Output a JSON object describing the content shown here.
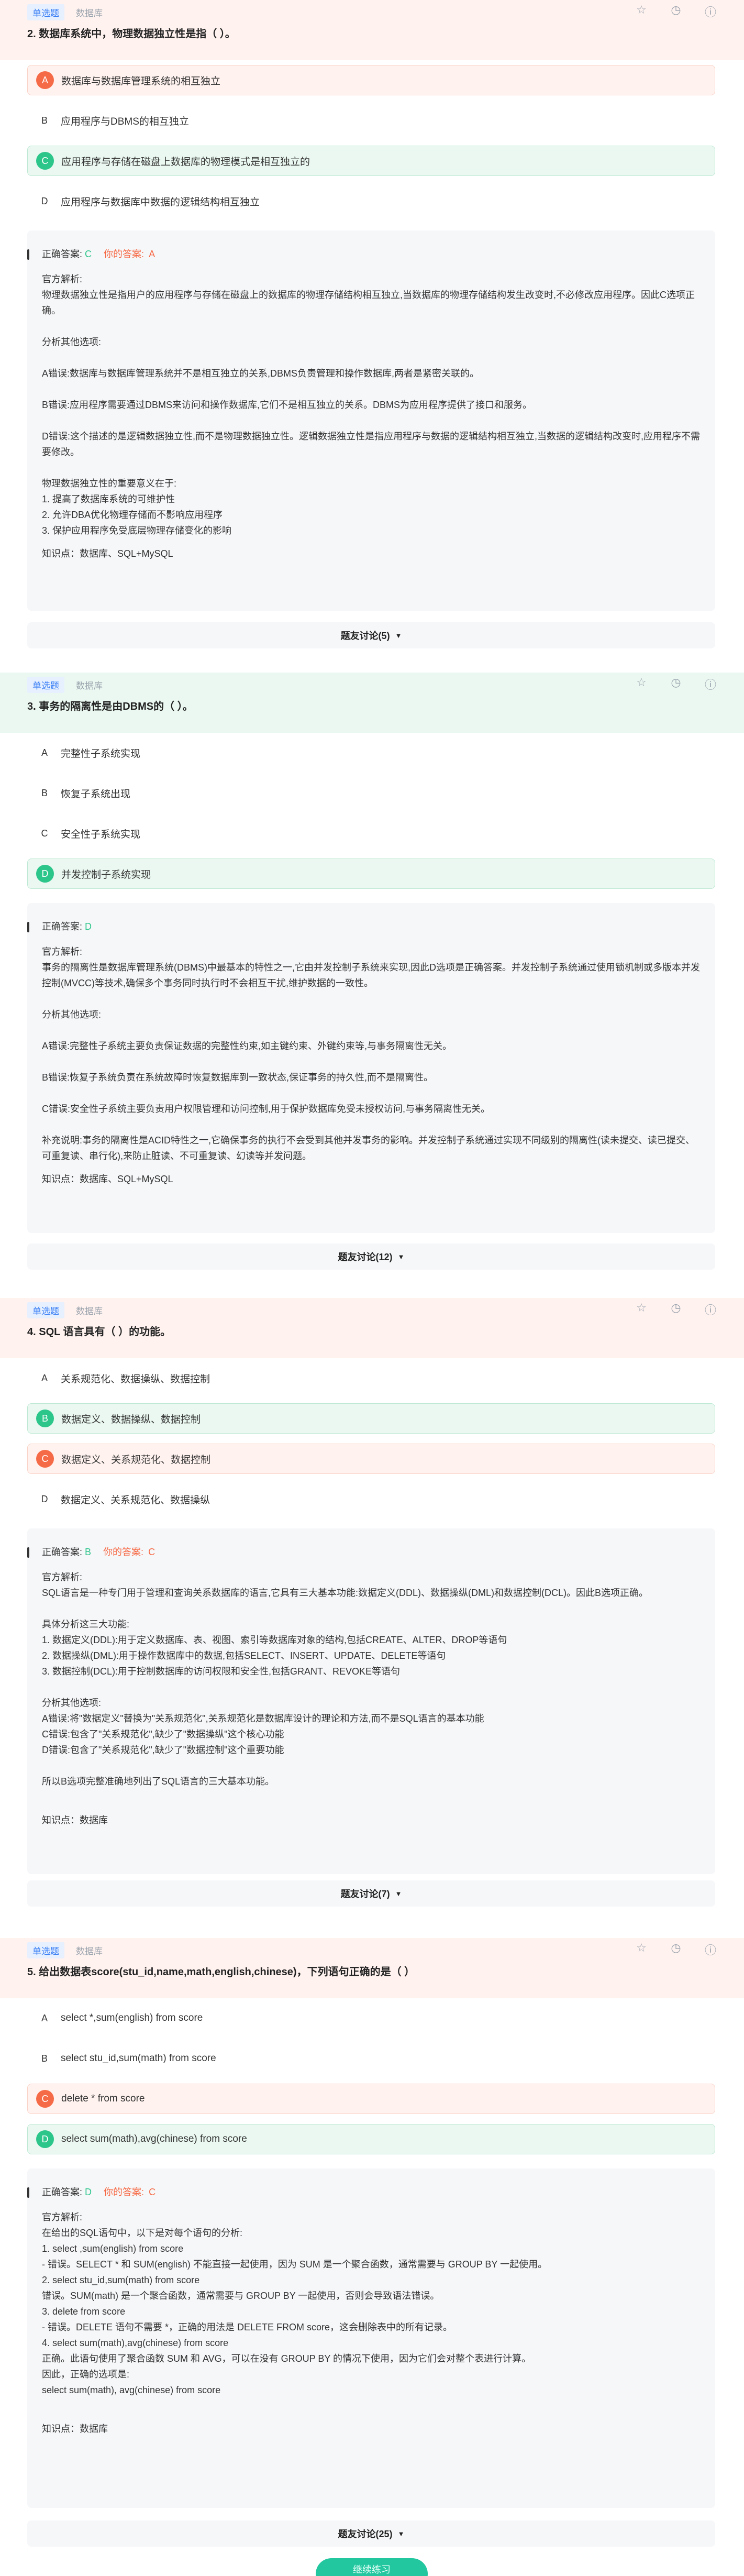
{
  "common": {
    "tag_type": "单选题",
    "tag_subject": "数据库",
    "correct_answer_label": "正确答案:",
    "my_answer_label": "你的答案:",
    "analysis_label": "官方解析:",
    "icons": [
      "star-icon",
      "clock-icon",
      "info-icon"
    ],
    "colors": {
      "correct": "#2cc58a",
      "wrong": "#f66b47",
      "accent": "#3b7ff5"
    }
  },
  "questions": [
    {
      "title": "2. 数据库系统中，物理数据独立性是指（ ）。",
      "options": [
        {
          "letter": "A",
          "text": "数据库与数据库管理系统的相互独立",
          "state": "wrong"
        },
        {
          "letter": "B",
          "text": "应用程序与DBMS的相互独立",
          "state": "none"
        },
        {
          "letter": "C",
          "text": "应用程序与存储在磁盘上数据库的物理模式是相互独立的",
          "state": "correct"
        },
        {
          "letter": "D",
          "text": "应用程序与数据库中数据的逻辑结构相互独立",
          "state": "none"
        }
      ],
      "correct": "C",
      "mine": "A",
      "explanation": [
        "物理数据独立性是指用户的应用程序与存储在磁盘上的数据库的物理存储结构相互独立,当数据库的物理存储结构发生改变时,不必修改应用程序。因此C选项正确。",
        "",
        "分析其他选项:",
        "",
        "A错误:数据库与数据库管理系统并不是相互独立的关系,DBMS负责管理和操作数据库,两者是紧密关联的。",
        "",
        "B错误:应用程序需要通过DBMS来访问和操作数据库,它们不是相互独立的关系。DBMS为应用程序提供了接口和服务。",
        "",
        "D错误:这个描述的是逻辑数据独立性,而不是物理数据独立性。逻辑数据独立性是指应用程序与数据的逻辑结构相互独立,当数据的逻辑结构改变时,应用程序不需要修改。",
        "",
        "物理数据独立性的重要意义在于:",
        "1. 提高了数据库系统的可维护性",
        "2. 允许DBA优化物理存储而不影响应用程序",
        "3. 保护应用程序免受底层物理存储变化的影响"
      ],
      "knowledge": "知识点：数据库、SQL+MySQL",
      "discussion": "题友讨论(5)"
    },
    {
      "title": "3. 事务的隔离性是由DBMS的（ ）。",
      "options": [
        {
          "letter": "A",
          "text": "完整性子系统实现",
          "state": "none"
        },
        {
          "letter": "B",
          "text": "恢复子系统出现",
          "state": "none"
        },
        {
          "letter": "C",
          "text": "安全性子系统实现",
          "state": "none"
        },
        {
          "letter": "D",
          "text": "并发控制子系统实现",
          "state": "correct"
        }
      ],
      "correct": "D",
      "mine": "",
      "explanation": [
        "事务的隔离性是数据库管理系统(DBMS)中最基本的特性之一,它由并发控制子系统来实现,因此D选项是正确答案。并发控制子系统通过使用锁机制或多版本并发控制(MVCC)等技术,确保多个事务同时执行时不会相互干扰,维护数据的一致性。",
        "",
        "分析其他选项:",
        "",
        "A错误:完整性子系统主要负责保证数据的完整性约束,如主键约束、外键约束等,与事务隔离性无关。",
        "",
        "B错误:恢复子系统负责在系统故障时恢复数据库到一致状态,保证事务的持久性,而不是隔离性。",
        "",
        "C错误:安全性子系统主要负责用户权限管理和访问控制,用于保护数据库免受未授权访问,与事务隔离性无关。",
        "",
        "补充说明:事务的隔离性是ACID特性之一,它确保事务的执行不会受到其他并发事务的影响。并发控制子系统通过实现不同级别的隔离性(读未提交、读已提交、可重复读、串行化),来防止脏读、不可重复读、幻读等并发问题。"
      ],
      "knowledge": "知识点：数据库、SQL+MySQL",
      "discussion": "题友讨论(12)"
    },
    {
      "title": "4. SQL 语言具有（ ）的功能。",
      "options": [
        {
          "letter": "A",
          "text": "关系规范化、数据操纵、数据控制",
          "state": "none"
        },
        {
          "letter": "B",
          "text": "数据定义、数据操纵、数据控制",
          "state": "correct"
        },
        {
          "letter": "C",
          "text": "数据定义、关系规范化、数据控制",
          "state": "wrong"
        },
        {
          "letter": "D",
          "text": "数据定义、关系规范化、数据操纵",
          "state": "none"
        }
      ],
      "correct": "B",
      "mine": "C",
      "explanation": [
        "SQL语言是一种专门用于管理和查询关系数据库的语言,它具有三大基本功能:数据定义(DDL)、数据操纵(DML)和数据控制(DCL)。因此B选项正确。",
        "",
        "具体分析这三大功能:",
        "1. 数据定义(DDL):用于定义数据库、表、视图、索引等数据库对象的结构,包括CREATE、ALTER、DROP等语句",
        "2. 数据操纵(DML):用于操作数据库中的数据,包括SELECT、INSERT、UPDATE、DELETE等语句",
        "3. 数据控制(DCL):用于控制数据库的访问权限和安全性,包括GRANT、REVOKE等语句",
        "",
        "分析其他选项:",
        "A错误:将\"数据定义\"替换为\"关系规范化\",关系规范化是数据库设计的理论和方法,而不是SQL语言的基本功能",
        "C错误:包含了\"关系规范化\",缺少了\"数据操纵\"这个核心功能",
        "D错误:包含了\"关系规范化\",缺少了\"数据控制\"这个重要功能",
        "",
        "所以B选项完整准确地列出了SQL语言的三大基本功能。"
      ],
      "knowledge": "知识点：数据库",
      "discussion": "题友讨论(7)"
    },
    {
      "title": "5. 给出数据表score(stu_id,name,math,english,chinese)，下列语句正确的是（ ）",
      "options": [
        {
          "letter": "A",
          "text": "select *,sum(english) from score",
          "state": "none"
        },
        {
          "letter": "B",
          "text": "select stu_id,sum(math) from score",
          "state": "none"
        },
        {
          "letter": "C",
          "text": "delete * from score",
          "state": "wrong"
        },
        {
          "letter": "D",
          "text": "select sum(math),avg(chinese) from score",
          "state": "correct"
        }
      ],
      "correct": "D",
      "mine": "C",
      "explanation": [
        "在给出的SQL语句中，以下是对每个语句的分析:",
        "1. select ,sum(english) from score",
        "- 错误。SELECT * 和 SUM(english) 不能直接一起使用，因为 SUM 是一个聚合函数，通常需要与 GROUP BY 一起使用。",
        "2. select stu_id,sum(math) from score",
        "错误。SUM(math) 是一个聚合函数，通常需要与 GROUP BY 一起使用，否则会导致语法错误。",
        "3. delete from score",
        "- 错误。DELETE 语句不需要 *，正确的用法是 DELETE FROM score，这会删除表中的所有记录。",
        "4. select sum(math),avg(chinese) from score",
        "正确。此语句使用了聚合函数 SUM 和 AVG，可以在没有 GROUP BY 的情况下使用，因为它们会对整个表进行计算。",
        "因此，正确的选项是:",
        "select sum(math), avg(chinese) from score",
        ""
      ],
      "knowledge": "知识点：数据库",
      "discussion": "题友讨论(25)"
    }
  ],
  "submit_label": "继续练习"
}
